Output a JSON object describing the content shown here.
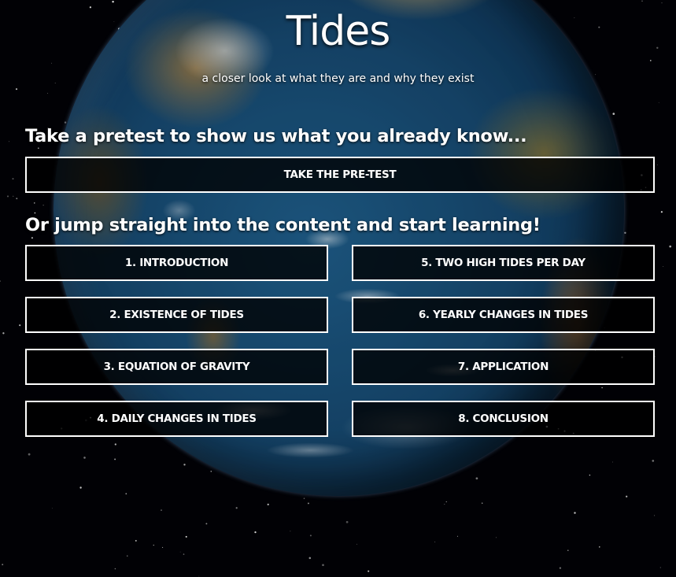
{
  "page": {
    "title": "Tides",
    "subtitle": "a closer look at what they are and why they exist"
  },
  "pretest": {
    "heading": "Take a pretest to show us what you already know...",
    "button_label": "TAKE THE PRE-TEST"
  },
  "content": {
    "heading": "Or jump straight into the content and start learning!",
    "sections": [
      {
        "label": "1. INTRODUCTION"
      },
      {
        "label": "2. EXISTENCE OF TIDES"
      },
      {
        "label": "3. EQUATION OF GRAVITY"
      },
      {
        "label": "4. DAILY CHANGES IN TIDES"
      },
      {
        "label": "5. TWO HIGH TIDES PER DAY"
      },
      {
        "label": "6. YEARLY CHANGES IN TIDES"
      },
      {
        "label": "7. APPLICATION"
      },
      {
        "label": "8. CONCLUSION"
      }
    ]
  },
  "background": {
    "image": "earth-globe-in-starfield",
    "colors": {
      "space": "#020206",
      "ocean": "#174a72",
      "button_border": "#ffffff",
      "button_fill": "#000000",
      "text": "#ffffff"
    }
  }
}
